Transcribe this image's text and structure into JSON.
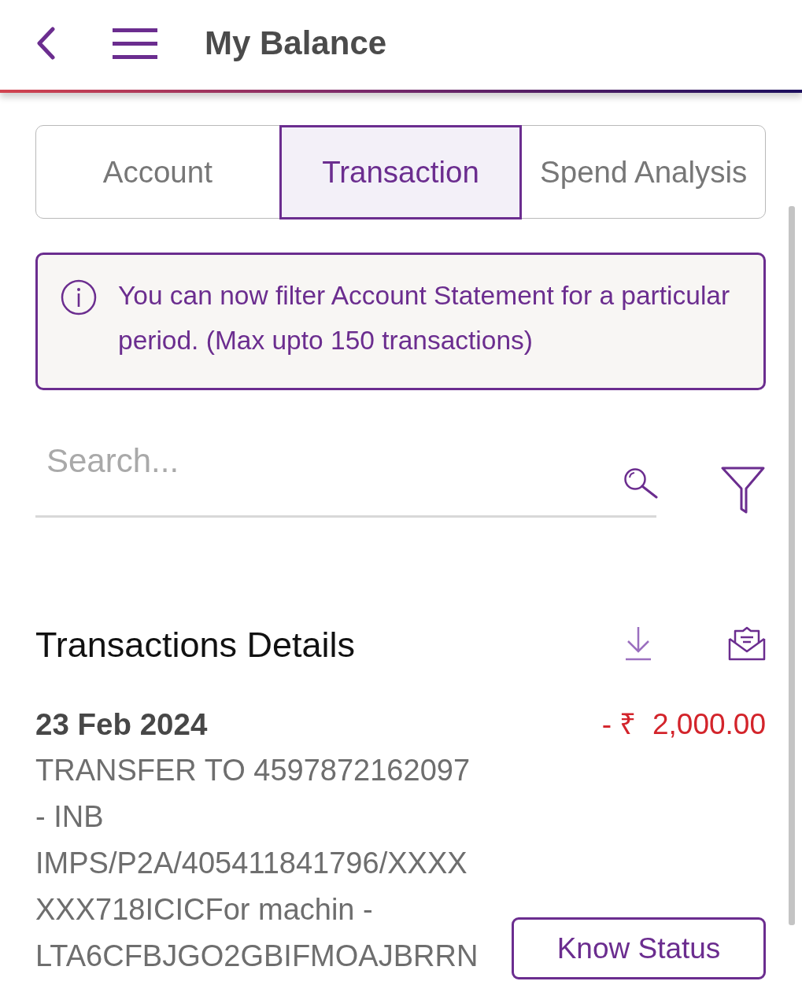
{
  "header": {
    "title": "My Balance"
  },
  "tabs": [
    {
      "label": "Account",
      "selected": false
    },
    {
      "label": "Transaction",
      "selected": true
    },
    {
      "label": "Spend Analysis",
      "selected": false
    }
  ],
  "notice": {
    "text": "You can now filter Account Statement for a particular period. (Max upto 150 transactions)"
  },
  "search": {
    "placeholder": "Search..."
  },
  "transactions_section": {
    "title": "Transactions Details"
  },
  "transactions": [
    {
      "date": "23 Feb 2024",
      "description": "TRANSFER TO 4597872162097 - INB IMPS/P2A/405411841796/XXXXXXX718ICICFor machin - LTA6CFBJGO2GBIFMOAJBRRN",
      "amount": "- ₹  2,000.00",
      "color": "#d3242b",
      "action": "Know Status"
    }
  ]
}
